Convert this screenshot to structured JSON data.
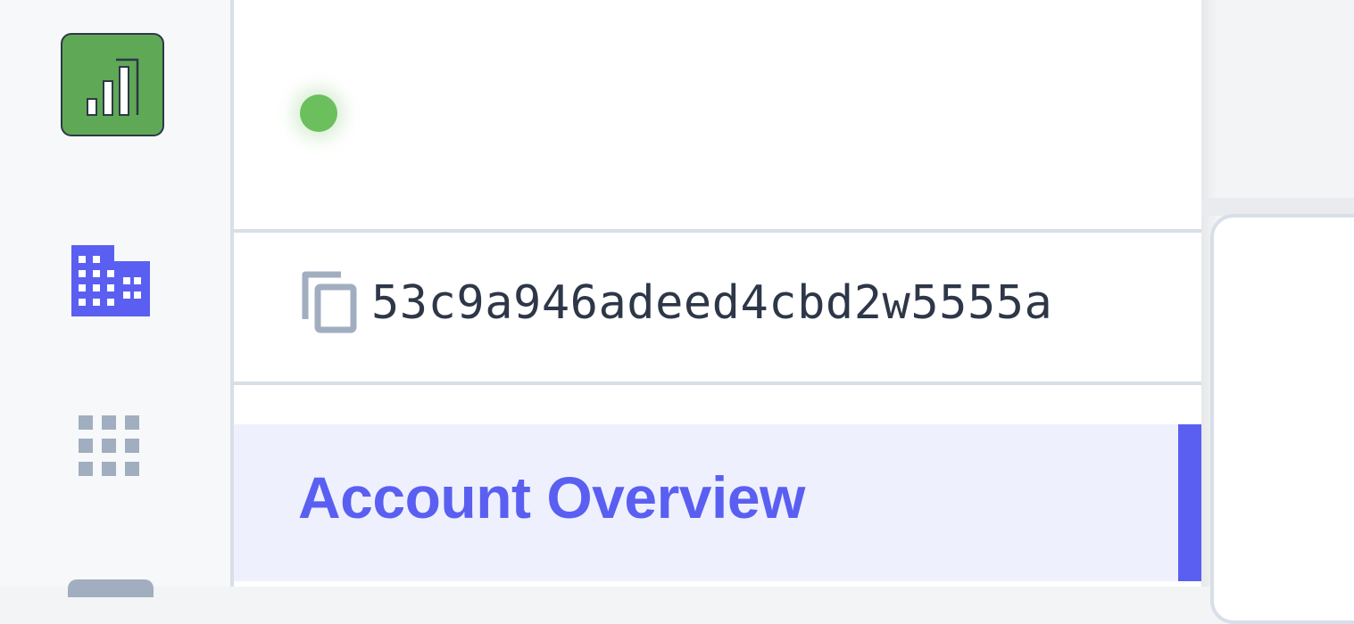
{
  "rail": {
    "logo": {
      "icon": "bar-chart-logo-icon",
      "color": "#5fa956"
    },
    "items": [
      {
        "icon": "building-icon",
        "active": true,
        "color": "#5a5ff2"
      },
      {
        "icon": "apps-grid-icon",
        "active": false,
        "color": "#a0aec0"
      }
    ]
  },
  "panel": {
    "status": {
      "state": "online",
      "color": "#6cbf5d"
    },
    "account_id": "53c9a946adeed4cbd2w5555a",
    "nav": {
      "active_item": {
        "label": "Account Overview",
        "accent": "#5a5ff2"
      }
    }
  }
}
